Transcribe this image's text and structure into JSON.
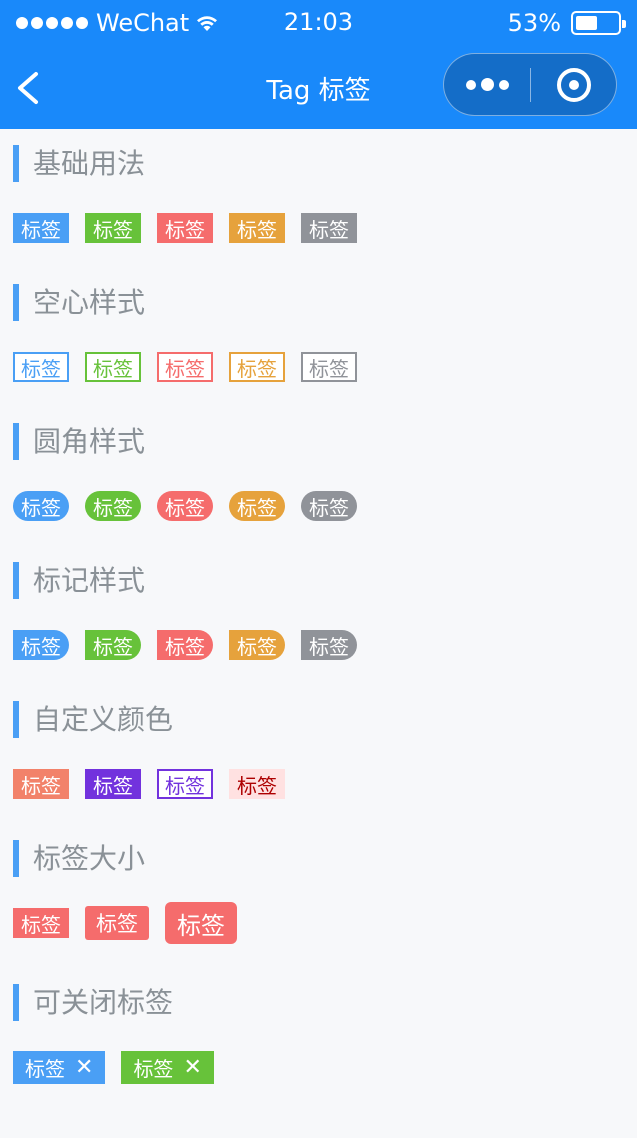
{
  "status_bar": {
    "carrier": "WeChat",
    "time": "21:03",
    "battery": "53%",
    "battery_level": 0.53
  },
  "nav": {
    "title": "Tag 标签"
  },
  "colors": {
    "primary": "#4a9ff5",
    "success": "#67c23a",
    "danger": "#f56c6c",
    "warning": "#e6a23c",
    "gray": "#909399",
    "custom_1": "#f2826a",
    "custom_2": "#7232dd",
    "custom_3_text": "#ad0000",
    "custom_3_bg": "#ffe1e1"
  },
  "sections": [
    {
      "title": "基础用法",
      "tags": [
        "标签",
        "标签",
        "标签",
        "标签",
        "标签"
      ]
    },
    {
      "title": "空心样式",
      "tags": [
        "标签",
        "标签",
        "标签",
        "标签",
        "标签"
      ]
    },
    {
      "title": "圆角样式",
      "tags": [
        "标签",
        "标签",
        "标签",
        "标签",
        "标签"
      ]
    },
    {
      "title": "标记样式",
      "tags": [
        "标签",
        "标签",
        "标签",
        "标签",
        "标签"
      ]
    },
    {
      "title": "自定义颜色",
      "tags": [
        "标签",
        "标签",
        "标签",
        "标签"
      ]
    },
    {
      "title": "标签大小",
      "tags": [
        "标签",
        "标签",
        "标签"
      ]
    },
    {
      "title": "可关闭标签",
      "tags": [
        "标签",
        "标签"
      ]
    }
  ]
}
